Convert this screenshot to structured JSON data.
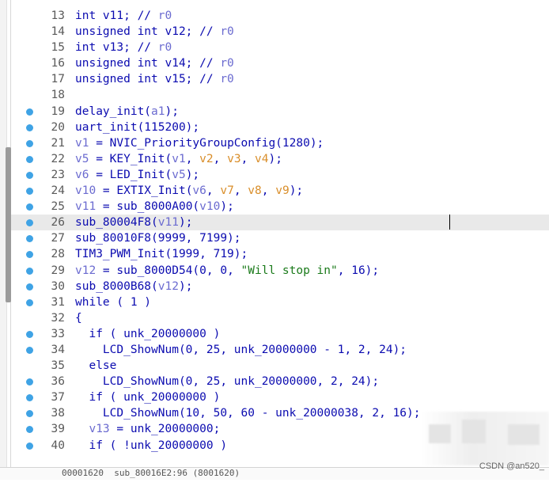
{
  "editor": {
    "lines": [
      {
        "num": "13",
        "bp": false,
        "segments": [
          {
            "t": "int v11; // ",
            "c": ""
          },
          {
            "t": "r0",
            "c": "tok-local"
          }
        ]
      },
      {
        "num": "14",
        "bp": false,
        "segments": [
          {
            "t": "unsigned int v12; // ",
            "c": ""
          },
          {
            "t": "r0",
            "c": "tok-local"
          }
        ]
      },
      {
        "num": "15",
        "bp": false,
        "segments": [
          {
            "t": "int v13; // ",
            "c": ""
          },
          {
            "t": "r0",
            "c": "tok-local"
          }
        ]
      },
      {
        "num": "16",
        "bp": false,
        "segments": [
          {
            "t": "unsigned int v14; // ",
            "c": ""
          },
          {
            "t": "r0",
            "c": "tok-local"
          }
        ]
      },
      {
        "num": "17",
        "bp": false,
        "segments": [
          {
            "t": "unsigned int v15; // ",
            "c": ""
          },
          {
            "t": "r0",
            "c": "tok-local"
          }
        ]
      },
      {
        "num": "18",
        "bp": false,
        "segments": [
          {
            "t": "",
            "c": ""
          }
        ]
      },
      {
        "num": "19",
        "bp": true,
        "segments": [
          {
            "t": "delay_init(",
            "c": ""
          },
          {
            "t": "a1",
            "c": "tok-local"
          },
          {
            "t": ");",
            "c": ""
          }
        ]
      },
      {
        "num": "20",
        "bp": true,
        "segments": [
          {
            "t": "uart_init(115200);",
            "c": ""
          }
        ]
      },
      {
        "num": "21",
        "bp": true,
        "segments": [
          {
            "t": "v1",
            "c": "tok-local"
          },
          {
            "t": " = NVIC_PriorityGroupConfig(1280);",
            "c": ""
          }
        ]
      },
      {
        "num": "22",
        "bp": true,
        "segments": [
          {
            "t": "v5",
            "c": "tok-local"
          },
          {
            "t": " = KEY_Init(",
            "c": ""
          },
          {
            "t": "v1",
            "c": "tok-local"
          },
          {
            "t": ", ",
            "c": ""
          },
          {
            "t": "v2",
            "c": "tok-arg"
          },
          {
            "t": ", ",
            "c": ""
          },
          {
            "t": "v3",
            "c": "tok-arg"
          },
          {
            "t": ", ",
            "c": ""
          },
          {
            "t": "v4",
            "c": "tok-arg"
          },
          {
            "t": ");",
            "c": ""
          }
        ]
      },
      {
        "num": "23",
        "bp": true,
        "segments": [
          {
            "t": "v6",
            "c": "tok-local"
          },
          {
            "t": " = LED_Init(",
            "c": ""
          },
          {
            "t": "v5",
            "c": "tok-local"
          },
          {
            "t": ");",
            "c": ""
          }
        ]
      },
      {
        "num": "24",
        "bp": true,
        "segments": [
          {
            "t": "v10",
            "c": "tok-local"
          },
          {
            "t": " = EXTIX_Init(",
            "c": ""
          },
          {
            "t": "v6",
            "c": "tok-local"
          },
          {
            "t": ", ",
            "c": ""
          },
          {
            "t": "v7",
            "c": "tok-arg"
          },
          {
            "t": ", ",
            "c": ""
          },
          {
            "t": "v8",
            "c": "tok-arg"
          },
          {
            "t": ", ",
            "c": ""
          },
          {
            "t": "v9",
            "c": "tok-arg"
          },
          {
            "t": ");",
            "c": ""
          }
        ]
      },
      {
        "num": "25",
        "bp": true,
        "segments": [
          {
            "t": "v11",
            "c": "tok-local"
          },
          {
            "t": " = sub_8000A00(",
            "c": ""
          },
          {
            "t": "v10",
            "c": "tok-local"
          },
          {
            "t": ");",
            "c": ""
          }
        ]
      },
      {
        "num": "26",
        "bp": true,
        "current": true,
        "segments": [
          {
            "t": "sub_80004F8(",
            "c": ""
          },
          {
            "t": "v11",
            "c": "tok-local"
          },
          {
            "t": ");",
            "c": ""
          }
        ]
      },
      {
        "num": "27",
        "bp": true,
        "segments": [
          {
            "t": "sub_80010F8(9999, 7199);",
            "c": ""
          }
        ]
      },
      {
        "num": "28",
        "bp": true,
        "segments": [
          {
            "t": "TIM3_PWM_Init(1999, 719);",
            "c": ""
          }
        ]
      },
      {
        "num": "29",
        "bp": true,
        "segments": [
          {
            "t": "v12",
            "c": "tok-local"
          },
          {
            "t": " = sub_8000D54(0, 0, ",
            "c": ""
          },
          {
            "t": "\"Will stop in\"",
            "c": "tok-str"
          },
          {
            "t": ", 16);",
            "c": ""
          }
        ]
      },
      {
        "num": "30",
        "bp": true,
        "segments": [
          {
            "t": "sub_8000B68(",
            "c": ""
          },
          {
            "t": "v12",
            "c": "tok-local"
          },
          {
            "t": ");",
            "c": ""
          }
        ]
      },
      {
        "num": "31",
        "bp": true,
        "segments": [
          {
            "t": "while ( 1 )",
            "c": ""
          }
        ]
      },
      {
        "num": "32",
        "bp": false,
        "segments": [
          {
            "t": "{",
            "c": ""
          }
        ]
      },
      {
        "num": "33",
        "bp": true,
        "segments": [
          {
            "t": "  if ( unk_20000000 )",
            "c": ""
          }
        ]
      },
      {
        "num": "34",
        "bp": true,
        "segments": [
          {
            "t": "    LCD_ShowNum(0, 25, unk_20000000 - 1, 2, 24);",
            "c": ""
          }
        ]
      },
      {
        "num": "35",
        "bp": false,
        "segments": [
          {
            "t": "  else",
            "c": ""
          }
        ]
      },
      {
        "num": "36",
        "bp": true,
        "segments": [
          {
            "t": "    LCD_ShowNum(0, 25, unk_20000000, 2, 24);",
            "c": ""
          }
        ]
      },
      {
        "num": "37",
        "bp": true,
        "segments": [
          {
            "t": "  if ( unk_20000000 )",
            "c": ""
          }
        ]
      },
      {
        "num": "38",
        "bp": true,
        "segments": [
          {
            "t": "    LCD_ShowNum(10, 50, 60 - unk_20000038, 2, 16);",
            "c": ""
          }
        ]
      },
      {
        "num": "39",
        "bp": true,
        "segments": [
          {
            "t": "  ",
            "c": ""
          },
          {
            "t": "v13",
            "c": "tok-local"
          },
          {
            "t": " = unk_20000000;",
            "c": ""
          }
        ]
      },
      {
        "num": "40",
        "bp": true,
        "segments": [
          {
            "t": "  if ( !unk_20000000 )",
            "c": ""
          }
        ]
      }
    ]
  },
  "status_bar": {
    "text": "00001620  sub_80016E2:96 (8001620)"
  },
  "watermark": {
    "text": "CSDN @an520_"
  },
  "colors": {
    "breakpoint": "#3fa3e5",
    "code": "#0b0bb0",
    "local_var": "#6b6bd0",
    "argument": "#d98e2a",
    "string": "#1a7a1a",
    "current_line": "#e9e9e9"
  }
}
